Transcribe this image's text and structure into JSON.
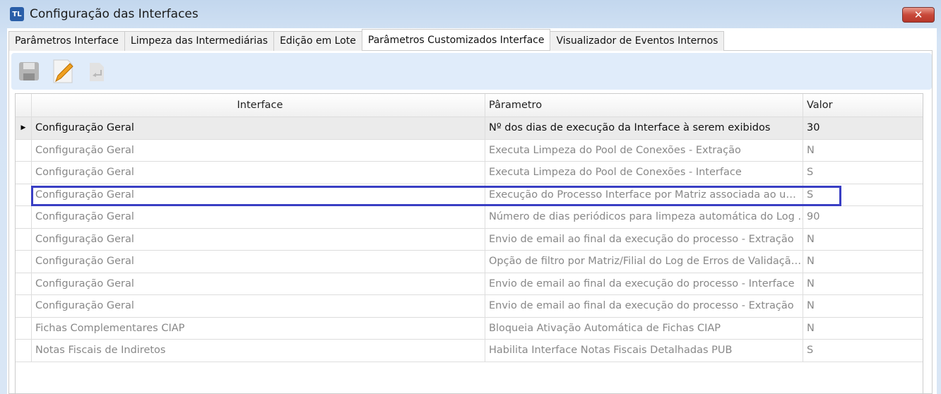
{
  "window": {
    "title": "Configuração das Interfaces",
    "icon_text": "TL"
  },
  "tabs": [
    {
      "label": "Parâmetros Interface"
    },
    {
      "label": "Limpeza das Intermediárias"
    },
    {
      "label": "Edição em Lote"
    },
    {
      "label": "Parâmetros Customizados Interface",
      "active": true
    },
    {
      "label": "Visualizador de Eventos Internos"
    }
  ],
  "grid": {
    "headers": {
      "interface": "Interface",
      "parametro": "Pârametro",
      "valor": "Valor"
    },
    "rows": [
      {
        "interface": "Configuração Geral",
        "parametro": "Nº dos dias de execução da Interface à serem exibidos",
        "valor": "30"
      },
      {
        "interface": "Configuração Geral",
        "parametro": "Executa Limpeza do Pool de Conexões - Extração",
        "valor": "N"
      },
      {
        "interface": "Configuração Geral",
        "parametro": "Executa Limpeza do Pool de Conexões - Interface",
        "valor": "S"
      },
      {
        "interface": "Configuração Geral",
        "parametro": "Execução do Processo Interface por Matriz associada ao u…",
        "valor": "S"
      },
      {
        "interface": "Configuração Geral",
        "parametro": "Número de dias periódicos para limpeza automática do Log …",
        "valor": "90"
      },
      {
        "interface": "Configuração Geral",
        "parametro": "Envio de email ao final da execução do processo - Extração",
        "valor": "N"
      },
      {
        "interface": "Configuração Geral",
        "parametro": "Opção de filtro por Matriz/Filial do Log de Erros de Validaçã…",
        "valor": "N"
      },
      {
        "interface": "Configuração Geral",
        "parametro": "Envio de email ao final da execução do processo - Interface",
        "valor": "N"
      },
      {
        "interface": "Configuração Geral",
        "parametro": "Envio de email ao final da execução do processo - Extração",
        "valor": "N"
      },
      {
        "interface": "Fichas Complementares CIAP",
        "parametro": "Bloqueia Ativação Automática de Fichas CIAP",
        "valor": "N"
      },
      {
        "interface": "Notas Fiscais de Indiretos",
        "parametro": "Habilita Interface Notas Fiscais Detalhadas PUB",
        "valor": "S"
      }
    ]
  },
  "colors": {
    "highlight": "#3a3fc4",
    "toolbar": "#e0ecfa"
  }
}
